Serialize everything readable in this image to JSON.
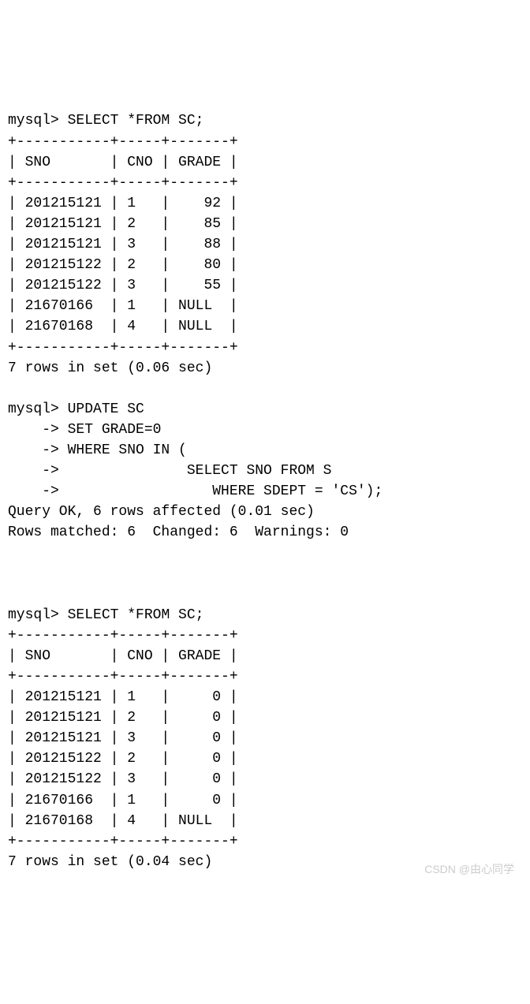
{
  "query1": {
    "prompt": "mysql> ",
    "sql": "SELECT *FROM SC;",
    "border": "+-----------+-----+-------+",
    "header": "| SNO       | CNO | GRADE |",
    "rows": [
      "| 201215121 | 1   |    92 |",
      "| 201215121 | 2   |    85 |",
      "| 201215121 | 3   |    88 |",
      "| 201215122 | 2   |    80 |",
      "| 201215122 | 3   |    55 |",
      "| 21670166  | 1   | NULL  |",
      "| 21670168  | 4   | NULL  |"
    ],
    "footer": "7 rows in set (0.06 sec)"
  },
  "update": {
    "line1": "mysql> UPDATE SC",
    "line2": "    -> SET GRADE=0",
    "line3": "    -> WHERE SNO IN (",
    "line4": "    ->               SELECT SNO FROM S",
    "line5": "    ->                  WHERE SDEPT = 'CS');",
    "result1": "Query OK, 6 rows affected (0.01 sec)",
    "result2": "Rows matched: 6  Changed: 6  Warnings: 0"
  },
  "query2": {
    "prompt": "mysql> ",
    "sql": "SELECT *FROM SC;",
    "border": "+-----------+-----+-------+",
    "header": "| SNO       | CNO | GRADE |",
    "rows": [
      "| 201215121 | 1   |     0 |",
      "| 201215121 | 2   |     0 |",
      "| 201215121 | 3   |     0 |",
      "| 201215122 | 2   |     0 |",
      "| 201215122 | 3   |     0 |",
      "| 21670166  | 1   |     0 |",
      "| 21670168  | 4   | NULL  |"
    ],
    "footer": "7 rows in set (0.04 sec)"
  },
  "watermark": "CSDN @由心同学"
}
